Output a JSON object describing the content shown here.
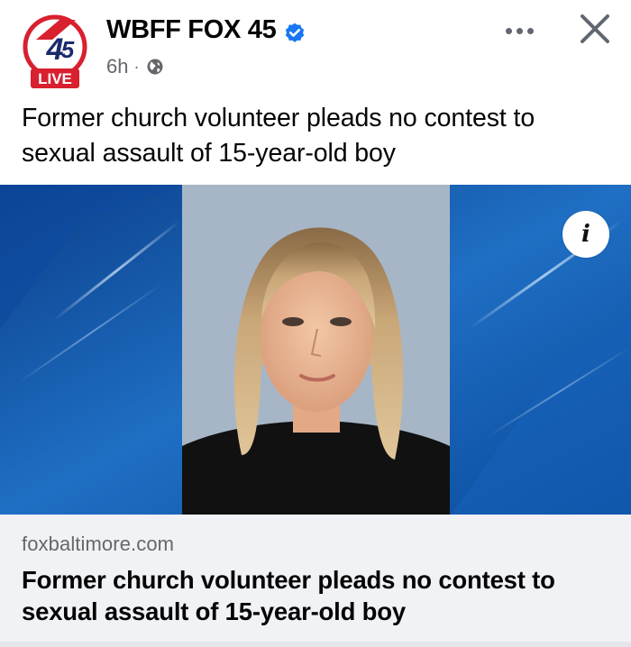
{
  "post": {
    "page_name": "WBFF FOX 45",
    "avatar_number": "45",
    "avatar_badge": "LIVE",
    "time": "6h",
    "separator": "·",
    "verified_icon": "verified-badge-icon",
    "audience_icon": "globe-icon",
    "text": "Former church volunteer pleads no contest to sexual assault of 15-year-old boy"
  },
  "actions": {
    "more_icon": "more-horizontal-icon",
    "close_icon": "close-icon",
    "info_icon": "info-icon",
    "info_label": "i"
  },
  "link_card": {
    "domain": "foxbaltimore.com",
    "title": "Former church volunteer pleads no contest to sexual assault of 15-year-old boy"
  },
  "colors": {
    "brand_red": "#d8202f",
    "verified_blue": "#1877f2",
    "background_blue": "#1f6fc4",
    "card_gray": "#f0f2f5",
    "meta_gray": "#65676b"
  }
}
